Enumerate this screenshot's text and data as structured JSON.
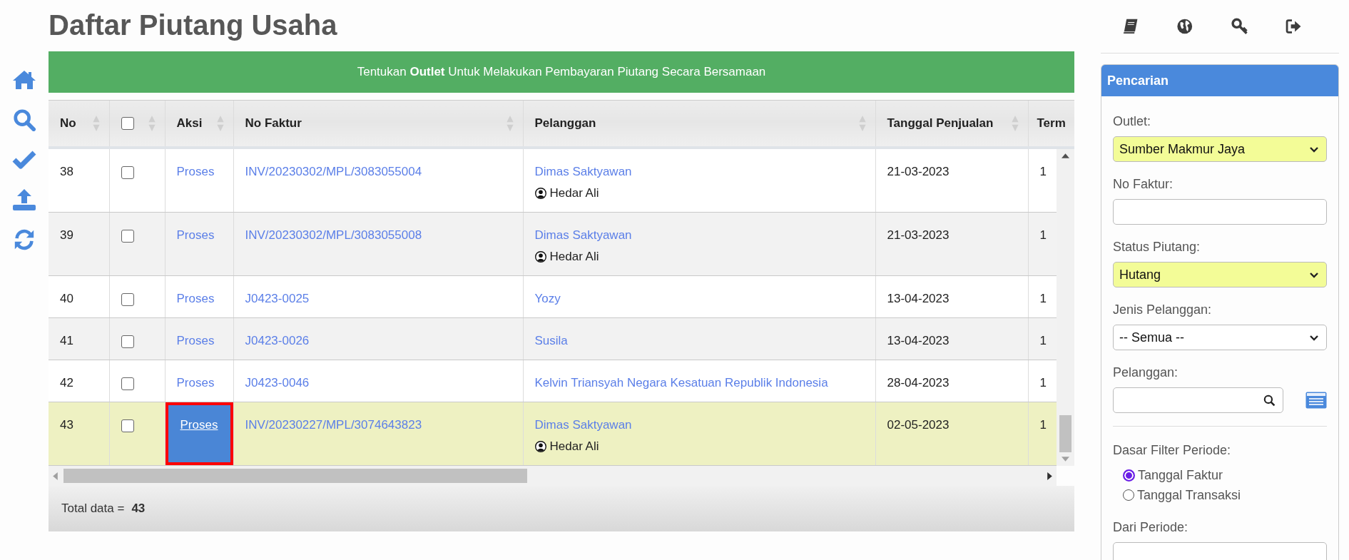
{
  "page": {
    "title": "Daftar Piutang Usaha"
  },
  "banner": {
    "text": "Tentukan **Outlet** Untuk Melakukan Pembayaran Piutang Secara Bersamaan"
  },
  "table": {
    "columns": [
      {
        "kind": "text",
        "label": "No",
        "sortable": true
      },
      {
        "kind": "checkbox",
        "checked": false,
        "sortable": true
      },
      {
        "kind": "text",
        "label": "Aksi",
        "sortable": true
      },
      {
        "kind": "text",
        "label": "No Faktur",
        "sortable": true
      },
      {
        "kind": "text",
        "label": "Pelanggan",
        "sortable": true
      },
      {
        "kind": "text",
        "label": "Tanggal Penjualan",
        "sortable": true
      },
      {
        "kind": "text",
        "label": "Term"
      }
    ],
    "rows": [
      {
        "no": "38",
        "checked": false,
        "action": "Proses",
        "action_marked": false,
        "invoice": "INV/20230302/MPL/3083055004",
        "customer": "Dimas Saktyawan",
        "salesperson": "Hedar Ali",
        "date": "21-03-2023",
        "column_7": "1",
        "selected": false
      },
      {
        "no": "39",
        "checked": false,
        "action": "Proses",
        "action_marked": false,
        "invoice": "INV/20230302/MPL/3083055008",
        "customer": "Dimas Saktyawan",
        "salesperson": "Hedar Ali",
        "date": "21-03-2023",
        "column_7": "1",
        "selected": false
      },
      {
        "no": "40",
        "checked": false,
        "action": "Proses",
        "action_marked": false,
        "invoice": "J0423-0025",
        "customer": "Yozy",
        "date": "13-04-2023",
        "column_7": "1",
        "selected": false
      },
      {
        "no": "41",
        "checked": false,
        "action": "Proses",
        "action_marked": false,
        "invoice": "J0423-0026",
        "customer": "Susila",
        "date": "13-04-2023",
        "column_7": "1",
        "selected": false
      },
      {
        "no": "42",
        "checked": false,
        "action": "Proses",
        "action_marked": false,
        "invoice": "J0423-0046",
        "customer": "Kelvin Triansyah Negara Kesatuan Republik Indonesia",
        "date": "28-04-2023",
        "column_7": "1",
        "selected": false
      },
      {
        "no": "43",
        "checked": false,
        "action": "Proses",
        "action_marked": true,
        "invoice": "INV/20230227/MPL/3074643823",
        "customer": "Dimas Saktyawan",
        "salesperson": "Hedar Ali",
        "date": "02-05-2023",
        "column_7": "1",
        "selected": true
      }
    ]
  },
  "footer": {
    "label": "Total data =",
    "count": "43"
  },
  "search_panel": {
    "title": "Pencarian",
    "fields": [
      {
        "kind": "select",
        "label": "Outlet:",
        "value": "Sumber Makmur Jaya",
        "highlighted": true
      },
      {
        "kind": "text",
        "label": "No Faktur:"
      },
      {
        "kind": "select",
        "label": "Status Piutang:",
        "value": "Hutang",
        "highlighted": true
      },
      {
        "kind": "select",
        "label": "Jenis Pelanggan:",
        "value": "-- Semua --",
        "highlighted": false
      },
      {
        "kind": "search",
        "label": "Pelanggan:"
      }
    ],
    "period_basis": {
      "label": "Dasar Filter Periode:",
      "options": [
        {
          "label": "Tanggal Faktur",
          "selected": true
        },
        {
          "label": "Tanggal Transaksi",
          "selected": false
        }
      ]
    },
    "period_fields": [
      {
        "kind": "text",
        "label": "Dari Periode:"
      }
    ]
  }
}
